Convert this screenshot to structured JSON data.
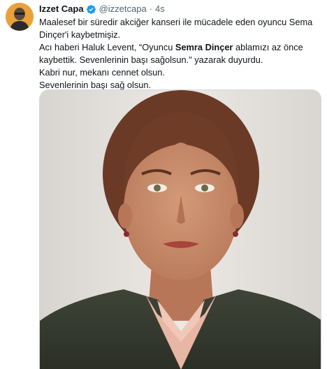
{
  "tweet": {
    "author": {
      "display_name": "Izzet Capa",
      "handle": "@izzetcapa",
      "verified": true,
      "avatar_color": "#e9a23b"
    },
    "separator": "·",
    "timestamp": "4s",
    "text": {
      "line1": "Maalesef bir süredir akciğer kanseri ile mücadele eden oyuncu Sema Dinçer'i kaybetmişiz.",
      "line2_before": "Acı haberi Haluk Levent, “Oyuncu ",
      "line2_bold": "Semra Dinçer",
      "line2_after": " ablamızı az önce kaybettik. Sevenlerinin başı sağolsun.\" yazarak duyurdu.",
      "line3": "Kabri nur, mekanı cennet olsun.",
      "line4": "Sevenlerinin başı sağ olsun."
    },
    "media": {
      "type": "photo"
    }
  },
  "colors": {
    "verified_badge": "#1d9bf0",
    "secondary_text": "#536471",
    "primary_text": "#0f1419"
  }
}
